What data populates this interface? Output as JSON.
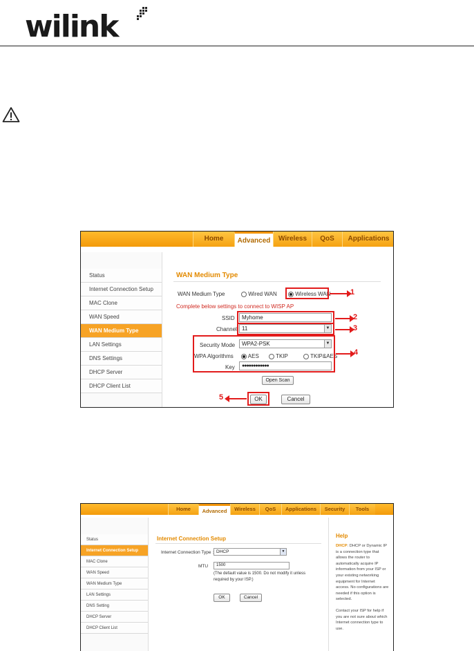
{
  "brand": {
    "logo_text": "wilink"
  },
  "shot1": {
    "nav_tabs": [
      "Home",
      "Advanced",
      "Wireless",
      "QoS",
      "Applications"
    ],
    "active_tab": 1,
    "sidebar": [
      "Status",
      "Internet Connection Setup",
      "MAC Clone",
      "WAN Speed",
      "WAN Medium Type",
      "LAN Settings",
      "DNS Settings",
      "DHCP Server",
      "DHCP Client List"
    ],
    "active_sidebar": 4,
    "section_title": "WAN Medium Type",
    "medium_label": "WAN Medium Type",
    "wired_label": "Wired WAN",
    "wireless_label": "Wireless WAN",
    "notice": "Complete below settings to connect to WISP AP",
    "ssid_label": "SSID",
    "ssid_value": "Myhome",
    "channel_label": "Channel",
    "channel_value": "11",
    "security_label": "Security Mode",
    "security_value": "WPA2-PSK",
    "wpa_label": "WPA Algorithms",
    "alg_aes": "AES",
    "alg_tkip": "TKIP",
    "alg_both": "TKIP&AES",
    "key_label": "Key",
    "key_value": "●●●●●●●●●●●●",
    "open_scan": "Open Scan",
    "ok": "OK",
    "cancel": "Cancel",
    "callouts": [
      "1",
      "2",
      "3",
      "4",
      "5"
    ]
  },
  "shot2": {
    "nav_tabs": [
      "Home",
      "Advanced",
      "Wireless",
      "QoS",
      "Applications",
      "Security",
      "Tools"
    ],
    "active_tab": 1,
    "sidebar": [
      "Status",
      "Internet Connection Setup",
      "MAC Clone",
      "WAN Speed",
      "WAN Medium Type",
      "LAN Settings",
      "DNS Setting",
      "DHCP Server",
      "DHCP Client List"
    ],
    "active_sidebar": 1,
    "section_title": "Internet Connection Setup",
    "conn_label": "Internet Connection Type :",
    "conn_value": "DHCP",
    "mtu_label": "MTU",
    "mtu_value": "1500",
    "mtu_hint1": "(The default value is 1500. Do not modify it unless",
    "mtu_hint2": "required by your ISP.)",
    "ok": "OK",
    "cancel": "Cancel",
    "help_title": "Help",
    "help_kw": "DHCP",
    "help_body": ": DHCP or Dynamic IP is a connection type that allows the router to automatically acquire IP information from your ISP or your existing networking equipment for Internet access. No configurations are needed if this option is selected.",
    "help_contact": "Contact your ISP for help if you are not sure about which Internet connection type to use."
  },
  "colors": {
    "accent_orange": "#f7a325",
    "callout_red": "#e21b1b"
  }
}
